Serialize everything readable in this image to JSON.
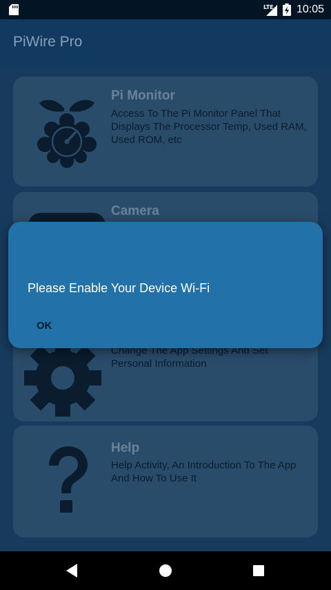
{
  "status_bar": {
    "network_label": "LTE",
    "time": "10:05",
    "icons": [
      "sd-card-icon",
      "signal-icon",
      "battery-charging-icon"
    ]
  },
  "app_bar": {
    "title": "PiWire Pro"
  },
  "cards": [
    {
      "title": "Pi Monitor",
      "description": "Access To The Pi Monitor Panel That Displays The Processor Temp, Used RAM, Used ROM, etc",
      "icon": "raspberry-pi-gauge-icon"
    },
    {
      "title": "Camera",
      "description": "",
      "icon": "camera-icon"
    },
    {
      "title": "",
      "description": "Change The App Settings And Set Personal Information",
      "icon": "gear-icon"
    },
    {
      "title": "Help",
      "description": "Help Activity, An Introduction To The App And How To Use It",
      "icon": "question-mark-icon"
    }
  ],
  "dialog": {
    "message": "Please Enable Your Device Wi-Fi",
    "ok_label": "OK"
  },
  "nav_bar": {
    "icons": [
      "back-icon",
      "home-icon",
      "recents-icon"
    ]
  },
  "colors": {
    "status_bar": "#031424",
    "app_bar": "#123a60",
    "background": "#173b5d",
    "card": "#2a4c6b",
    "dialog": "#2271a8",
    "icon": "#0a1c2d"
  }
}
